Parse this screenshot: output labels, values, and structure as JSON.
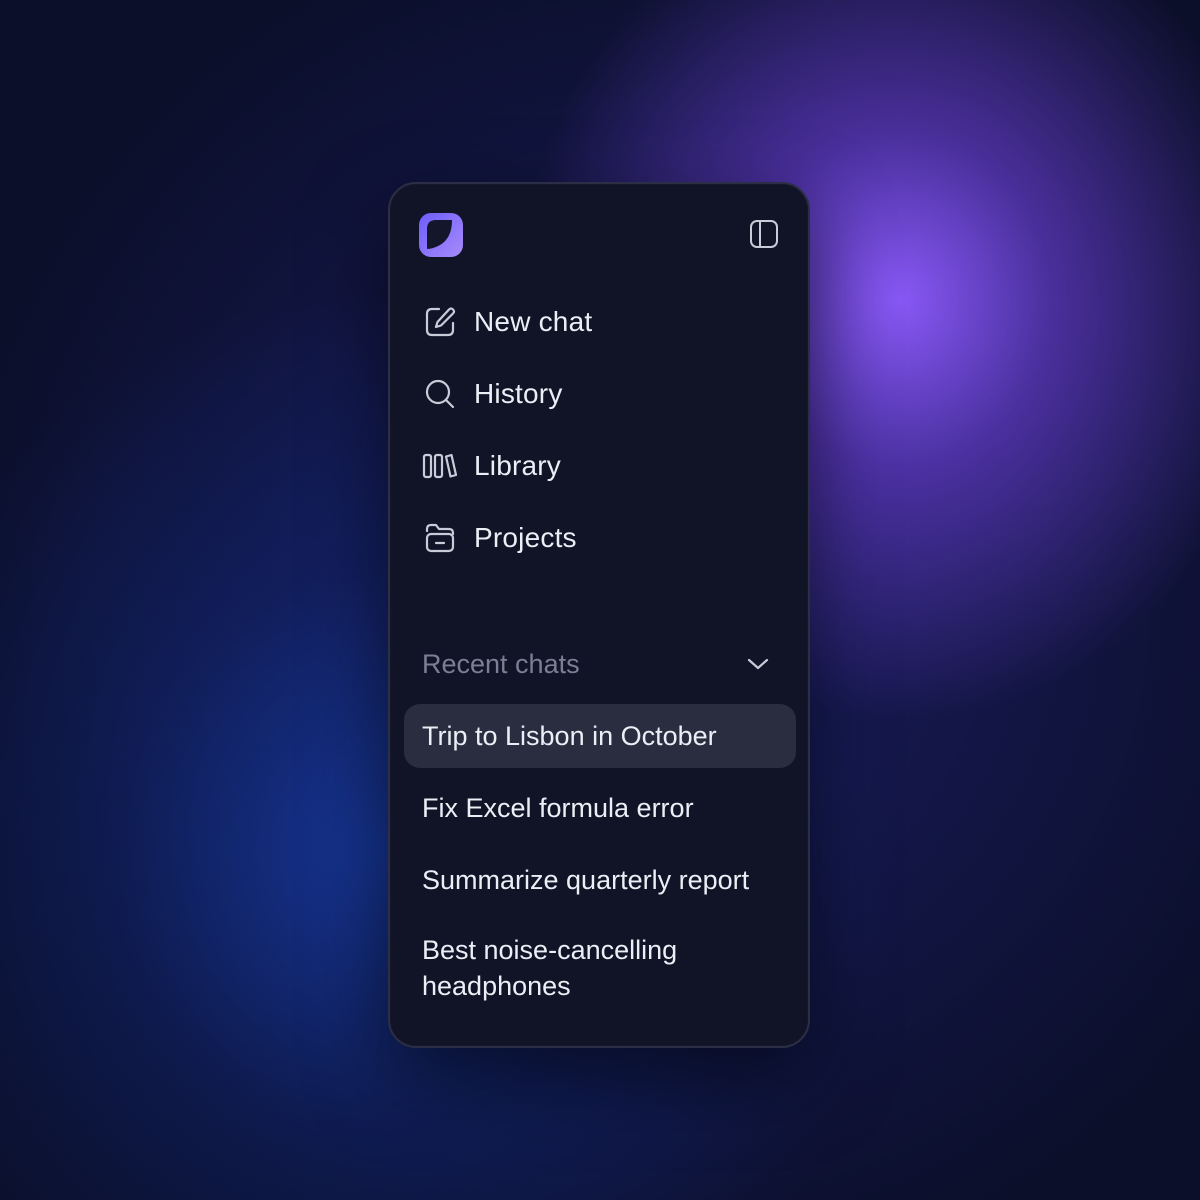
{
  "colors": {
    "panel_background": "#111327",
    "active_item_background": "#2a2c40",
    "text_primary": "#eceef6",
    "text_muted": "#7b7f96",
    "accent": "#8b5cf6"
  },
  "header": {
    "logo_icon": "app-logo-icon",
    "toggle_icon": "sidebar-toggle-icon"
  },
  "nav": [
    {
      "label": "New chat",
      "icon": "edit-icon"
    },
    {
      "label": "History",
      "icon": "search-icon"
    },
    {
      "label": "Library",
      "icon": "library-icon"
    },
    {
      "label": "Projects",
      "icon": "folder-icon"
    }
  ],
  "recent": {
    "title": "Recent chats",
    "expanded": true,
    "chats": [
      {
        "label": "Trip to Lisbon in October",
        "active": true
      },
      {
        "label": "Fix Excel formula error",
        "active": false
      },
      {
        "label": "Summarize quarterly report",
        "active": false
      },
      {
        "label": "Best noise-cancelling headphones",
        "active": false
      }
    ]
  }
}
